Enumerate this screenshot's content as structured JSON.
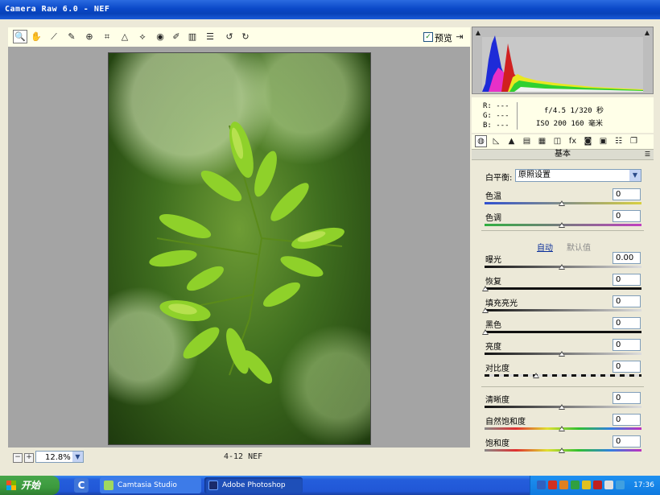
{
  "window": {
    "title": "Camera Raw 6.0 -  NEF"
  },
  "toolbar": {
    "tools": [
      {
        "name": "zoom-tool-icon",
        "glyph": "🔍"
      },
      {
        "name": "hand-tool-icon",
        "glyph": "✋"
      },
      {
        "name": "white-balance-tool-icon",
        "glyph": "⟋"
      },
      {
        "name": "color-sampler-tool-icon",
        "glyph": "✎"
      },
      {
        "name": "targeted-adjustment-tool-icon",
        "glyph": "⊕"
      },
      {
        "name": "crop-tool-icon",
        "glyph": "⌗"
      },
      {
        "name": "straighten-tool-icon",
        "glyph": "△"
      },
      {
        "name": "spot-removal-tool-icon",
        "glyph": "⟡"
      },
      {
        "name": "red-eye-tool-icon",
        "glyph": "◉"
      },
      {
        "name": "adjustment-brush-icon",
        "glyph": "✐"
      },
      {
        "name": "graduated-filter-icon",
        "glyph": "▥"
      },
      {
        "name": "preferences-icon",
        "glyph": "☰"
      },
      {
        "name": "rotate-left-icon",
        "glyph": "↺"
      },
      {
        "name": "rotate-right-icon",
        "glyph": "↻"
      }
    ],
    "preview_checked": "✓",
    "preview_label": "预览",
    "exit_glyph": "⇥"
  },
  "status": {
    "zoom_minus": "−",
    "zoom_plus": "+",
    "zoom_value": "12.8%",
    "file_info": "4-12 NEF"
  },
  "histogram": {
    "clip_left": "▲",
    "clip_right": "▲"
  },
  "info": {
    "r": "R:  ---",
    "g": "G:  ---",
    "b": "B:  ---",
    "aperture_shutter": "f/4.5   1/320 秒",
    "iso_focal": "ISO 200   160 毫米"
  },
  "tabs": [
    {
      "name": "tab-basic-icon",
      "glyph": "◍"
    },
    {
      "name": "tab-tone-curve-icon",
      "glyph": "◺"
    },
    {
      "name": "tab-detail-icon",
      "glyph": "▲"
    },
    {
      "name": "tab-hsl-icon",
      "glyph": "▤"
    },
    {
      "name": "tab-split-toning-icon",
      "glyph": "▦"
    },
    {
      "name": "tab-lens-corrections-icon",
      "glyph": "◫"
    },
    {
      "name": "tab-effects-icon",
      "glyph": "fx"
    },
    {
      "name": "tab-camera-calibration-icon",
      "glyph": "◙"
    },
    {
      "name": "tab-presets-icon",
      "glyph": "▣"
    },
    {
      "name": "tab-settings-icon",
      "glyph": "☷"
    },
    {
      "name": "tab-snapshots-icon",
      "glyph": "❐"
    }
  ],
  "panel": {
    "title": "基本",
    "menu_glyph": "☰",
    "wb_label": "白平衡:",
    "wb_value": "原照设置",
    "auto": "自动",
    "default": "默认值",
    "sliders": [
      {
        "label": "色温",
        "value": "0",
        "pos": 0.5,
        "track": "linear-gradient(90deg,#3050d0,#d8d040)"
      },
      {
        "label": "色调",
        "value": "0",
        "pos": 0.5,
        "track": "linear-gradient(90deg,#30b040,#c040c0)"
      },
      {
        "label": "曝光",
        "value": "0.00",
        "pos": 0.5,
        "track": "linear-gradient(90deg,#111,#ddd)"
      },
      {
        "label": "恢复",
        "value": "0",
        "pos": 0.0,
        "track": "linear-gradient(90deg,#111,#111)"
      },
      {
        "label": "填充亮光",
        "value": "0",
        "pos": 0.0,
        "track": "linear-gradient(90deg,#111,#ddd)"
      },
      {
        "label": "黑色",
        "value": "0",
        "pos": 0.0,
        "track": "linear-gradient(90deg,#111,#111)"
      },
      {
        "label": "亮度",
        "value": "0",
        "pos": 0.5,
        "track": "linear-gradient(90deg,#111,#ddd)"
      },
      {
        "label": "对比度",
        "value": "0",
        "pos": 0.33,
        "track": "repeating-linear-gradient(90deg,#111 0 6px,#ddd 6px 12px)"
      },
      {
        "label": "清晰度",
        "value": "0",
        "pos": 0.5,
        "track": "linear-gradient(90deg,#111,#ddd)"
      },
      {
        "label": "自然饱和度",
        "value": "0",
        "pos": 0.5,
        "track": "linear-gradient(90deg,#888,#e03030,#e0e030,#30c030,#3080e0,#c030c0)"
      },
      {
        "label": "饱和度",
        "value": "0",
        "pos": 0.5,
        "track": "linear-gradient(90deg,#888,#e03030,#e0e030,#30c030,#3080e0,#c030c0)"
      }
    ]
  },
  "taskbar": {
    "start_label": "开始",
    "quick_launch": "C",
    "tasks": [
      {
        "label": "Camtasia Studio"
      },
      {
        "label": "Adobe Photoshop"
      }
    ],
    "clock": "17:36"
  }
}
